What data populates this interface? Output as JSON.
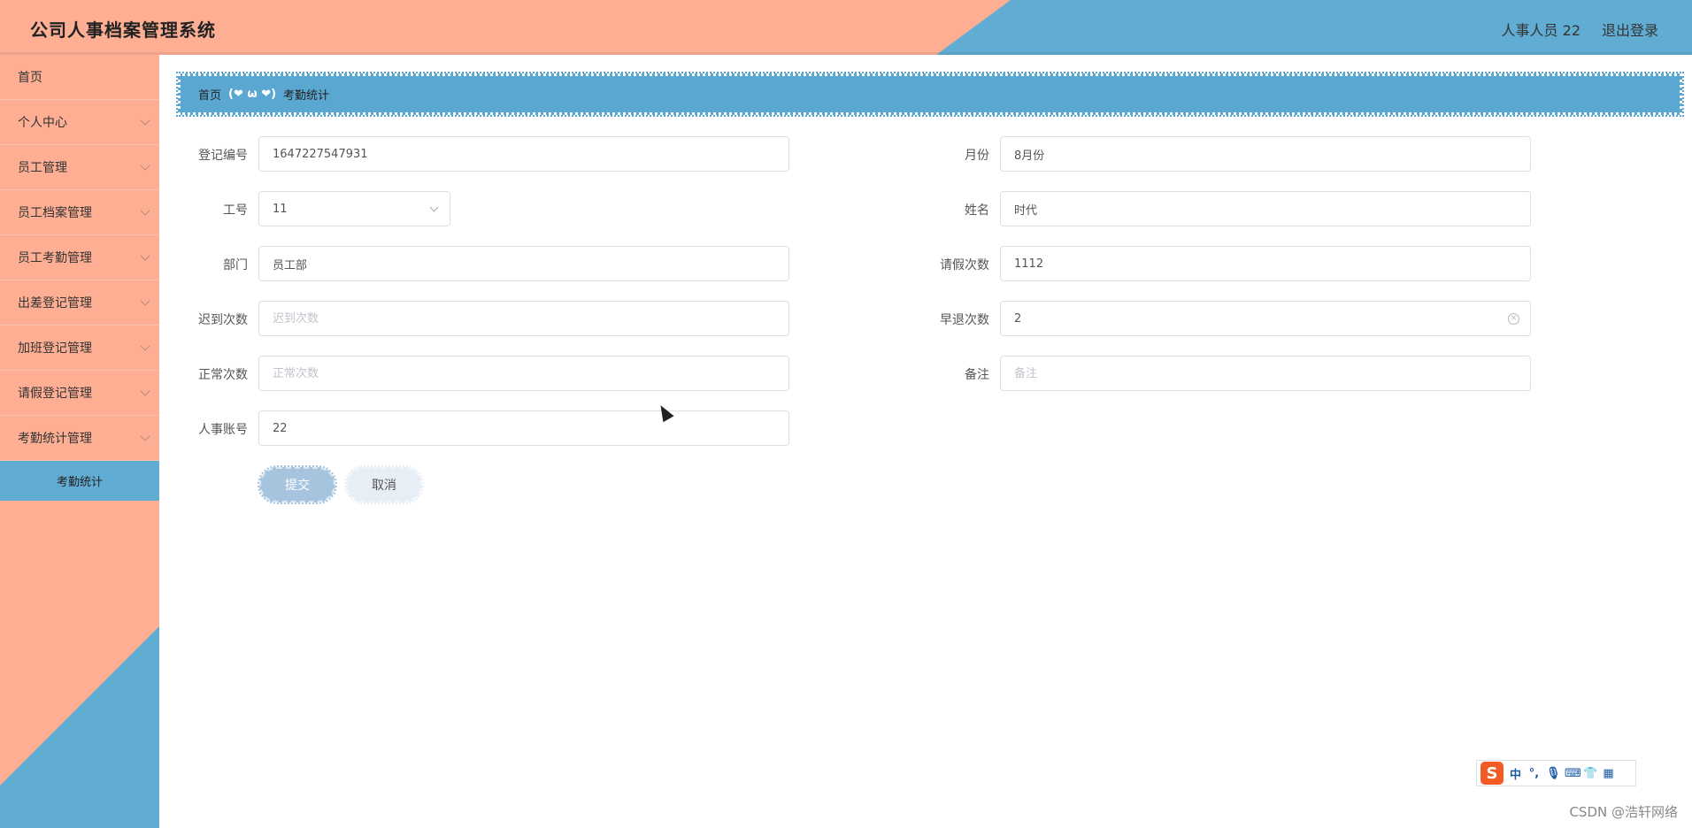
{
  "header": {
    "title": "公司人事档案管理系统",
    "user": "人事人员 22",
    "logout": "退出登录"
  },
  "sidebar": {
    "items": [
      {
        "label": "首页"
      },
      {
        "label": "个人中心"
      },
      {
        "label": "员工管理"
      },
      {
        "label": "员工档案管理"
      },
      {
        "label": "员工考勤管理"
      },
      {
        "label": "出差登记管理"
      },
      {
        "label": "加班登记管理"
      },
      {
        "label": "请假登记管理"
      },
      {
        "label": "考勤统计管理"
      }
    ],
    "active_sub": "考勤统计"
  },
  "breadcrumb": {
    "home": "首页",
    "separator": "(❤ ω ❤)",
    "current": "考勤统计"
  },
  "form": {
    "reg_no": {
      "label": "登记编号",
      "value": "1647227547931"
    },
    "month": {
      "label": "月份",
      "value": "8月份"
    },
    "emp_no": {
      "label": "工号",
      "value": "11"
    },
    "name": {
      "label": "姓名",
      "value": "时代"
    },
    "dept": {
      "label": "部门",
      "value": "员工部"
    },
    "leave_count": {
      "label": "请假次数",
      "value": "1112"
    },
    "late_count": {
      "label": "迟到次数",
      "placeholder": "迟到次数"
    },
    "early_count": {
      "label": "早退次数",
      "value": "2"
    },
    "normal_count": {
      "label": "正常次数",
      "placeholder": "正常次数"
    },
    "remark": {
      "label": "备注",
      "placeholder": "备注"
    },
    "hr_account": {
      "label": "人事账号",
      "value": "22"
    },
    "submit": "提交",
    "cancel": "取消"
  },
  "ime": {
    "logo": "S",
    "mode": "中",
    "punct": "°,"
  },
  "watermark": "CSDN @浩轩网络",
  "colors": {
    "salmon": "#fdae93",
    "blue": "#61acd2"
  }
}
